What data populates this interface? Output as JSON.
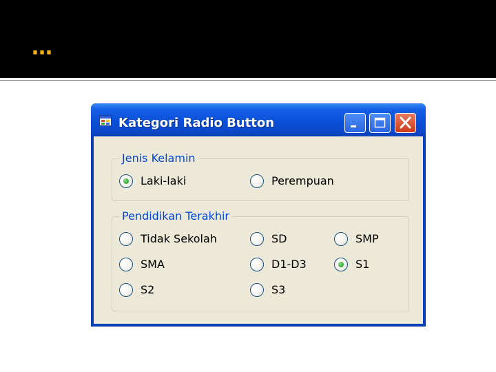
{
  "slide": {
    "title": "…",
    "header_bg": "#000000",
    "title_color": "#f0b41b"
  },
  "window": {
    "title": "Kategori Radio Button",
    "icon": "form-app-icon",
    "buttons": {
      "minimize": "minimize-icon",
      "maximize": "maximize-icon",
      "close": "close-icon"
    }
  },
  "groups": {
    "gender": {
      "legend": "Jenis Kelamin",
      "options": [
        {
          "label": "Laki-laki",
          "checked": true
        },
        {
          "label": "Perempuan",
          "checked": false
        }
      ]
    },
    "education": {
      "legend": "Pendidikan Terakhir",
      "options": [
        {
          "label": "Tidak Sekolah",
          "checked": false
        },
        {
          "label": "SD",
          "checked": false
        },
        {
          "label": "SMP",
          "checked": false
        },
        {
          "label": "SMA",
          "checked": false
        },
        {
          "label": "D1-D3",
          "checked": false
        },
        {
          "label": "S1",
          "checked": true
        },
        {
          "label": "S2",
          "checked": false
        },
        {
          "label": "S3",
          "checked": false
        }
      ]
    }
  }
}
